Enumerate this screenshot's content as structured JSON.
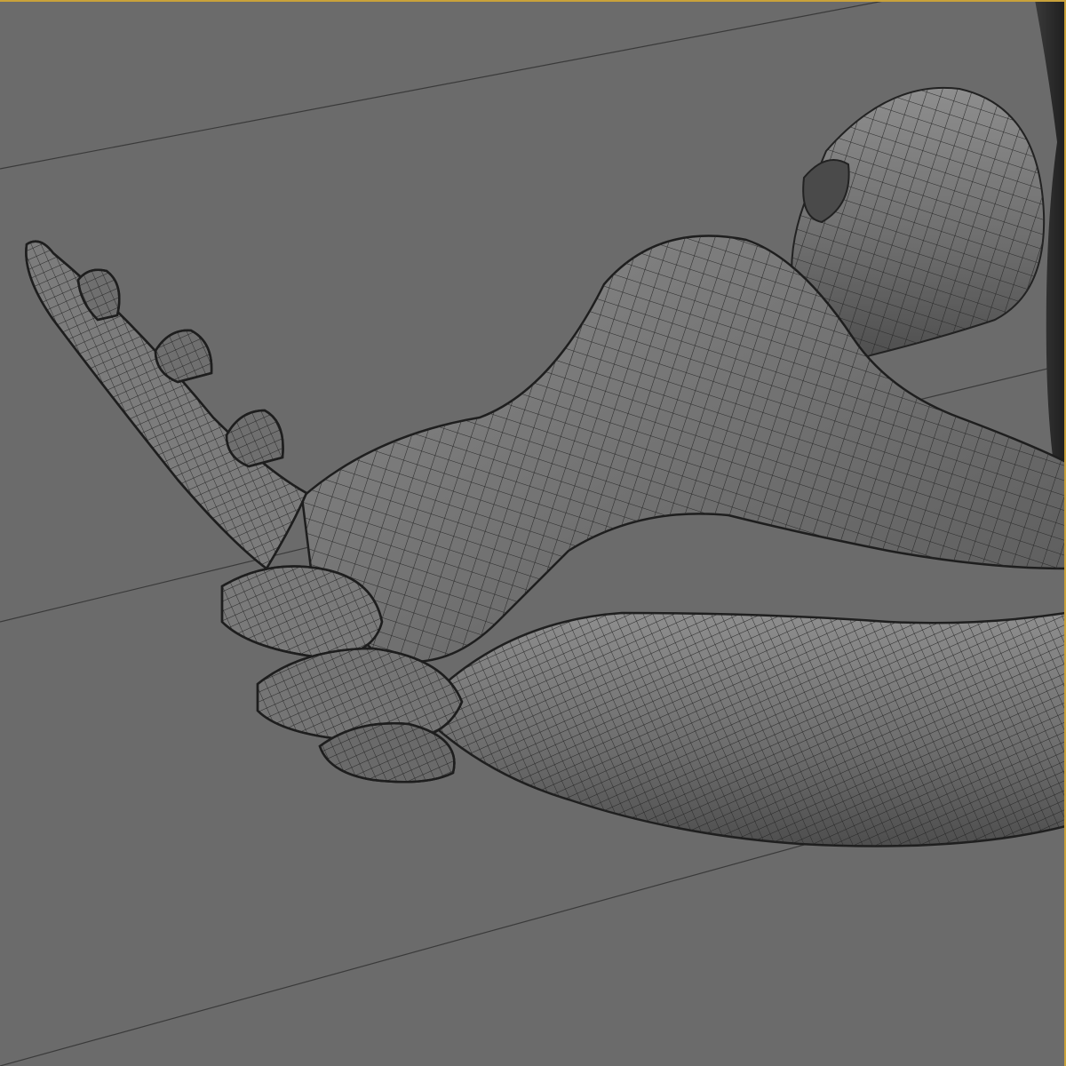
{
  "viewport": {
    "background": "#6b6b6b",
    "frame_color": "#c9a23a",
    "grid_line_color": "#3a3a3a"
  },
  "scene": {
    "mesh_fill": "#7a7a7a",
    "wire_color": "#2b2b2b"
  }
}
